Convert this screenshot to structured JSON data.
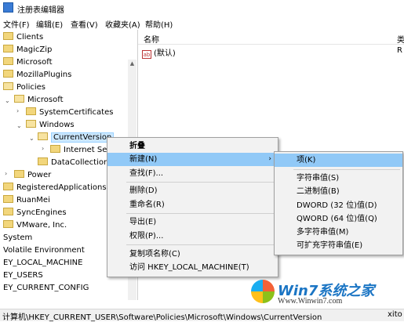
{
  "window": {
    "title": "注册表编辑器"
  },
  "menubar": [
    "文件(F)",
    "编辑(E)",
    "查看(V)",
    "收藏夹(A)",
    "帮助(H)"
  ],
  "tree": [
    {
      "label": "Clients"
    },
    {
      "label": "MagicZip"
    },
    {
      "label": "Microsoft"
    },
    {
      "label": "MozillaPlugins"
    },
    {
      "label": "Policies"
    },
    {
      "label": "Microsoft"
    },
    {
      "label": "SystemCertificates"
    },
    {
      "label": "Windows"
    },
    {
      "label": "CurrentVersion"
    },
    {
      "label": "Internet Sett"
    },
    {
      "label": "DataCollection"
    },
    {
      "label": "Power"
    },
    {
      "label": "RegisteredApplications"
    },
    {
      "label": "RuanMei"
    },
    {
      "label": "SyncEngines"
    },
    {
      "label": "VMware, Inc."
    },
    {
      "label": "System"
    },
    {
      "label": "Volatile Environment"
    },
    {
      "label": "EY_LOCAL_MACHINE"
    },
    {
      "label": "EY_USERS"
    },
    {
      "label": "EY_CURRENT_CONFIG"
    }
  ],
  "values_pane": {
    "header_name": "名称",
    "header_type_partial": "类",
    "default_value_name": "(默认)",
    "default_value_type_partial": "R",
    "ab_icon": "ab"
  },
  "context_menu": {
    "items": [
      "折叠",
      "新建(N)",
      "查找(F)...",
      "删除(D)",
      "重命名(R)",
      "导出(E)",
      "权限(P)...",
      "复制项名称(C)",
      "访问 HKEY_LOCAL_MACHINE(T)"
    ],
    "submenu_arrow": "›"
  },
  "submenu": {
    "items": [
      "项(K)",
      "字符串值(S)",
      "二进制值(B)",
      "DWORD (32 位)值(D)",
      "QWORD (64 位)值(Q)",
      "多字符串值(M)",
      "可扩充字符串值(E)"
    ]
  },
  "statusbar": {
    "path": "计算机\\HKEY_CURRENT_USER\\Software\\Policies\\Microsoft\\Windows\\CurrentVersion",
    "tail": "xito"
  },
  "watermark": {
    "brand": "Win7系统之家",
    "url": "Www.Winwin7.com"
  },
  "colors": {
    "highlight": "#91c9f7",
    "selection": "#cce8ff",
    "menu_bg": "#f2f2f2"
  }
}
